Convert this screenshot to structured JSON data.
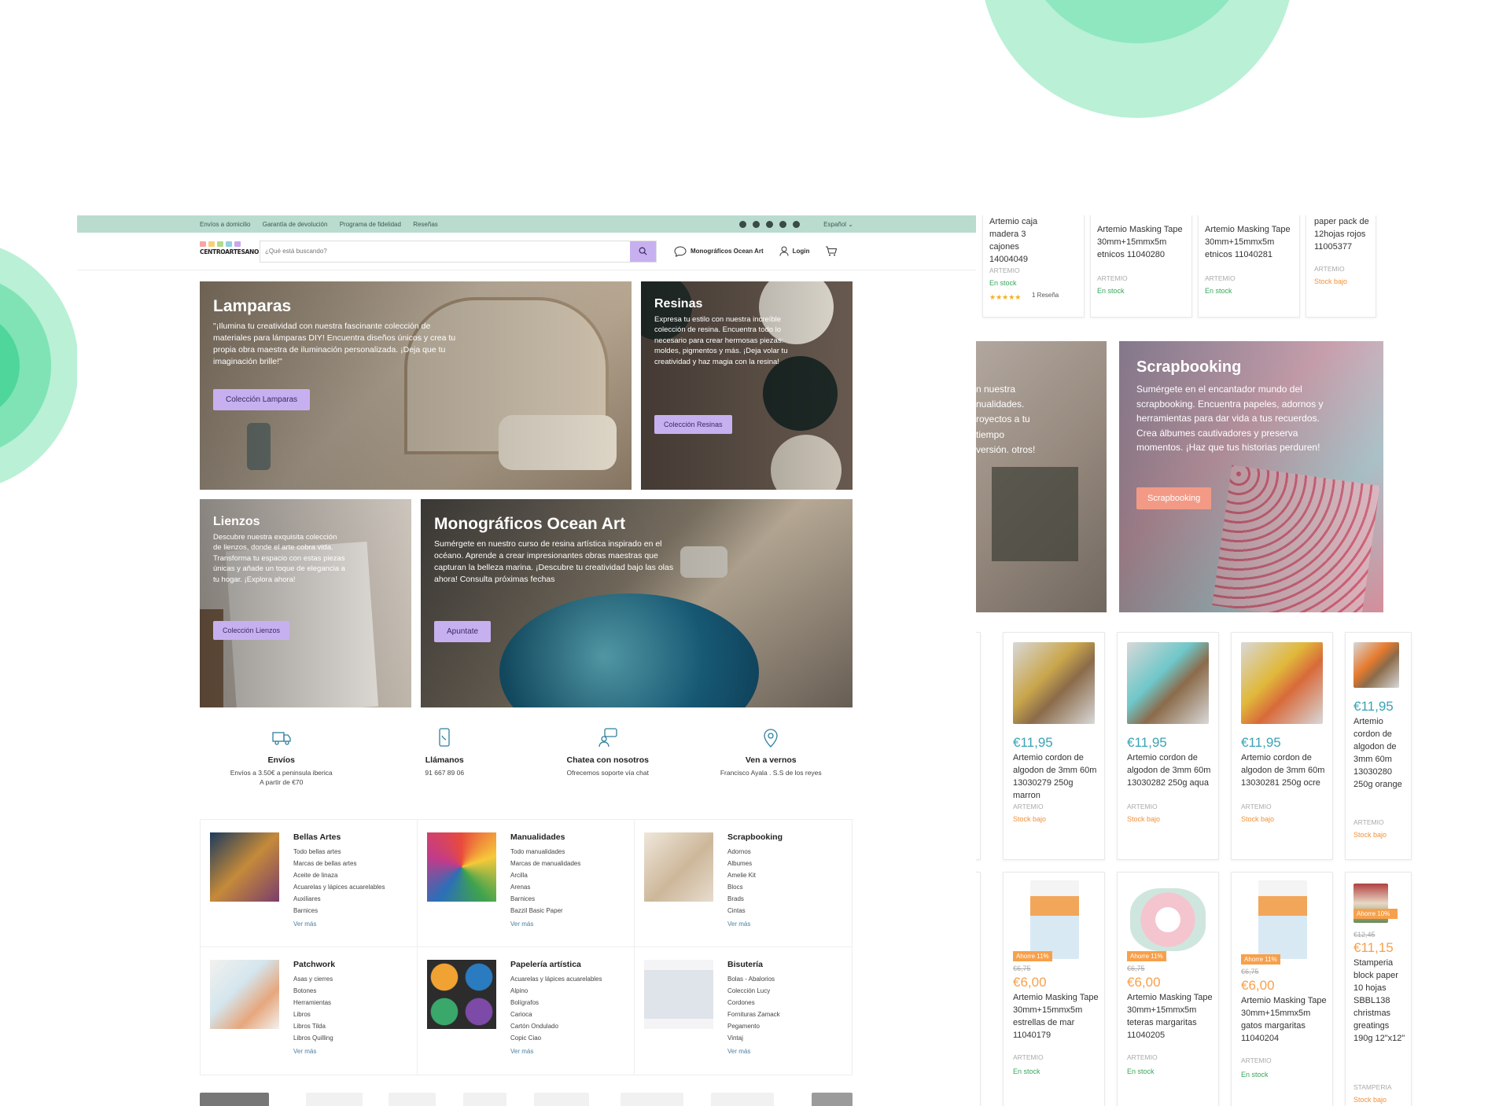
{
  "colors": {
    "topbar_bg": "#b9dccf",
    "accent_purple": "#c7b0f0",
    "decor_green": "#8ee7bf",
    "price_teal": "#3aa3b5",
    "sale_orange": "#f7a04b",
    "stock_green": "#3aa55c"
  },
  "topbar": {
    "links": [
      "Envíos a domicilio",
      "Garantía de devolución",
      "Programa de fidelidad",
      "Reseñas"
    ],
    "social_icons": [
      "mail-icon",
      "facebook-icon",
      "instagram-icon",
      "linkedin-icon",
      "pinterest-icon"
    ],
    "language": "Español ⌄"
  },
  "header": {
    "logo_text": "CENTROARTESANO",
    "search_placeholder": "¿Qué está buscando?",
    "nav": {
      "ocean": "Monográficos Ocean Art",
      "login": "Login"
    }
  },
  "tiles": {
    "lamparas": {
      "title": "Lamparas",
      "text": "\"¡Ilumina tu creatividad con nuestra fascinante colección de materiales para lámparas DIY! Encuentra diseños únicos y crea tu propia obra maestra de iluminación personalizada. ¡Deja que tu imaginación brille!\"",
      "button": "Colección Lamparas"
    },
    "resinas": {
      "title": "Resinas",
      "text": "Expresa tu estilo con nuestra increíble colección de resina. Encuentra todo lo necesario para crear hermosas piezas: moldes, pigmentos y más. ¡Deja volar tu creatividad y haz magia con la resina!",
      "button": "Colección Resinas"
    },
    "lienzos": {
      "title": "Lienzos",
      "text": "Descubre nuestra exquisita colección de lienzos, donde el arte cobra vida. Transforma tu espacio con estas piezas únicas y añade un toque de elegancia a tu hogar. ¡Explora ahora!",
      "button": "Colección Lienzos"
    },
    "ocean": {
      "title": "Monográficos Ocean Art",
      "text": "Sumérgete en nuestro curso de resina artística inspirado en el océano. Aprende a crear impresionantes obras maestras que capturan la belleza marina. ¡Descubre tu creatividad bajo las olas ahora! Consulta próximas fechas",
      "button": "Apuntate"
    }
  },
  "features": [
    {
      "icon": "truck-icon",
      "title": "Envíos",
      "line1": "Envíos a 3.50€ a peninsula iberica",
      "line2": "A partir de €70"
    },
    {
      "icon": "phone-icon",
      "title": "Llámanos",
      "line1": "91 667 89 06",
      "line2": ""
    },
    {
      "icon": "chat-icon",
      "title": "Chatea con nosotros",
      "line1": "Ofrecemos soporte vía chat",
      "line2": ""
    },
    {
      "icon": "location-icon",
      "title": "Ven a vernos",
      "line1": "Francisco Ayala . S.S de los reyes",
      "line2": ""
    }
  ],
  "categories": [
    {
      "title": "Bellas Artes",
      "items": [
        "Todo bellas artes",
        "Marcas de bellas artes",
        "Aceite de linaza",
        "Acuarelas y lápices acuarelables",
        "Auxiliares",
        "Barnices"
      ],
      "more": "Ver más"
    },
    {
      "title": "Manualidades",
      "items": [
        "Todo manualidades",
        "Marcas de manualidades",
        "Arcilla",
        "Arenas",
        "Barnices",
        "Bazzil Basic Paper"
      ],
      "more": "Ver más"
    },
    {
      "title": "Scrapbooking",
      "items": [
        "Adornos",
        "Albumes",
        "Amelie Kit",
        "Blocs",
        "Brads",
        "Cintas"
      ],
      "more": "Ver más"
    },
    {
      "title": "Patchwork",
      "items": [
        "Asas y cierres",
        "Botones",
        "Herramientas",
        "Libros",
        "Libros Tilda",
        "Libros Quilling"
      ],
      "more": "Ver más"
    },
    {
      "title": "Papelería artística",
      "items": [
        "Acuarelas y lápices acuarelables",
        "Alpino",
        "Bolígrafos",
        "Carioca",
        "Cartón Ondulado",
        "Copic Ciao"
      ],
      "more": "Ver más"
    },
    {
      "title": "Bisutería",
      "items": [
        "Bolas - Abalorios",
        "Colección Lucy",
        "Cordones",
        "Fornituras Zamack",
        "Pegamento",
        "Vintaj"
      ],
      "more": "Ver más"
    }
  ],
  "panel": {
    "top_cards": [
      {
        "title": "Artemio caja madera 3 cajones 14004049",
        "brand": "ARTEMIO",
        "stock": "En stock",
        "reviews": "1 Reseña"
      },
      {
        "title": "Artemio Masking Tape 30mm+15mmx5m etnicos 11040280",
        "brand": "ARTEMIO",
        "stock": "En stock"
      },
      {
        "title": "Artemio Masking Tape 30mm+15mmx5m etnicos 11040281",
        "brand": "ARTEMIO",
        "stock": "En stock"
      },
      {
        "title": "paper pack de 12hojas rojos 11005377",
        "brand": "ARTEMIO",
        "stock": "Stock bajo"
      }
    ],
    "left_banner_text": "n nuestra nualidades. royectos a tu tiempo versión. otros!",
    "scrap_banner": {
      "title": "Scrapbooking",
      "text": "Sumérgete en el encantador mundo del scrapbooking. Encuentra papeles, adornos y herramientas para dar vida a tus recuerdos. Crea álbumes cautivadores y preserva momentos. ¡Haz que tus historias perduren!",
      "button": "Scrapbooking"
    },
    "mid_cards": [
      {
        "price": "€11,95",
        "title": "Artemio cordon de algodon de 3mm 60m 13030279 250g marron",
        "brand": "ARTEMIO",
        "stock": "Stock bajo"
      },
      {
        "price": "€11,95",
        "title": "Artemio cordon de algodon de 3mm 60m 13030282 250g aqua",
        "brand": "ARTEMIO",
        "stock": "Stock bajo"
      },
      {
        "price": "€11,95",
        "title": "Artemio cordon de algodon de 3mm 60m 13030281 250g ocre",
        "brand": "ARTEMIO",
        "stock": "Stock bajo"
      },
      {
        "price": "€11,95",
        "title": "Artemio cordon de algodon de 3mm 60m 13030280 250g orange",
        "brand": "ARTEMIO",
        "stock": "Stock bajo"
      }
    ],
    "bottom_cards": [
      {
        "badge": "Ahorre 11%",
        "old": "€6,75",
        "price": "€6,00",
        "title": "Artemio Masking Tape 30mm+15mmx5m estrellas de mar 11040179",
        "brand": "ARTEMIO",
        "stock": "En stock"
      },
      {
        "badge": "Ahorre 11%",
        "old": "€6,75",
        "price": "€6,00",
        "title": "Artemio Masking Tape 30mm+15mmx5m teteras margaritas 11040205",
        "brand": "ARTEMIO",
        "stock": "En stock"
      },
      {
        "badge": "Ahorre 11%",
        "old": "€6,75",
        "price": "€6,00",
        "title": "Artemio Masking Tape 30mm+15mmx5m gatos margaritas 11040204",
        "brand": "ARTEMIO",
        "stock": "En stock"
      },
      {
        "badge": "Ahorre 10%",
        "old": "€12,45",
        "price": "€11,15",
        "title": "Stamperia block paper 10 hojas SBBL138 christmas greatings 190g 12\"x12\"",
        "brand": "STAMPERIA",
        "stock": "Stock bajo"
      }
    ]
  }
}
